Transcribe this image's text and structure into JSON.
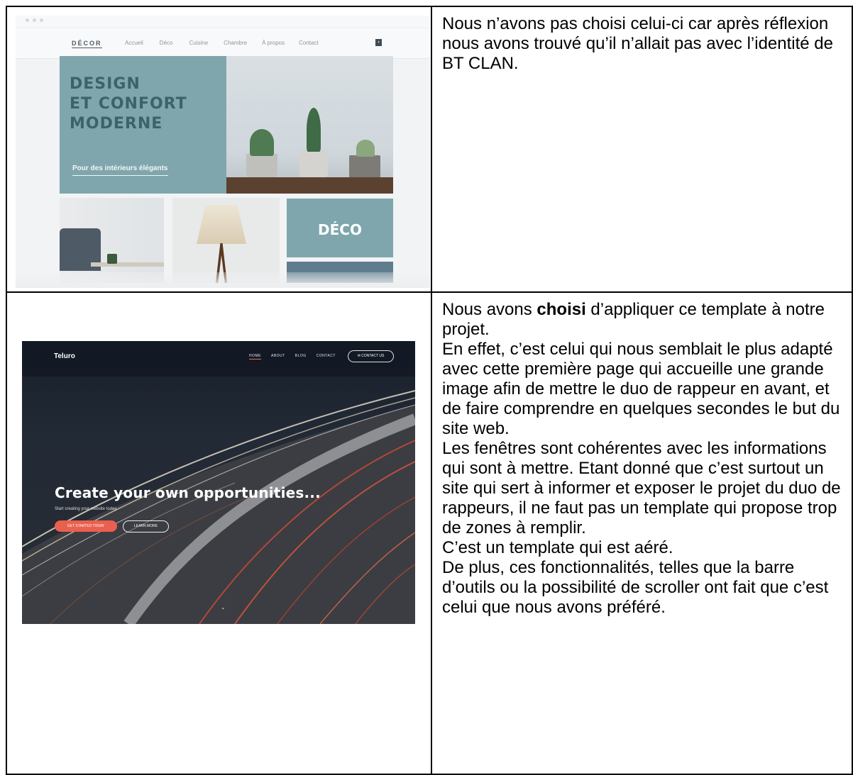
{
  "row1": {
    "thumbnail": {
      "brand": "DÉCOR",
      "nav": [
        "Accueil",
        "Déco",
        "Cuisine",
        "Chambre",
        "À propos",
        "Contact"
      ],
      "hero_title": [
        "DESIGN",
        "ET CONFORT",
        "MODERNE"
      ],
      "hero_subtitle": "Pour des intérieurs élégants",
      "tile_label": "DÉCO"
    },
    "text": "Nous n’avons pas choisi celui-ci car après réflexion nous avons trouvé qu’il n’allait pas avec l’identité de BT CLAN."
  },
  "row2": {
    "thumbnail": {
      "logo": "Teluro",
      "nav": [
        "HOME",
        "ABOUT",
        "BLOG",
        "CONTACT"
      ],
      "contact_button": "✉ CONTACT US",
      "title": "Create your own opportunities...",
      "subtitle": "Start creating your website today.",
      "primary_button": "GET STARTED TODAY",
      "secondary_button": "LEARN MORE",
      "scroll_icon": "chevron-down-icon"
    },
    "text_intro_before": "Nous avons ",
    "text_intro_bold": "choisi",
    "text_intro_after": " d’appliquer ce template à notre projet.",
    "paragraphs": [
      "En effet, c’est celui qui nous semblait le plus adapté avec cette première page qui accueille une grande image afin de mettre le duo de rappeur en avant, et de faire comprendre en quelques secondes le but du site web.",
      "Les fenêtres sont cohérentes avec les informations qui sont à mettre. Etant donné que c’est surtout un site qui sert à informer et exposer le projet du duo de rappeurs, il ne faut pas un template qui propose trop de zones à remplir.",
      "C’est un template qui est aéré.",
      "De plus, ces fonctionnalités, telles que la barre d’outils ou la possibilité de scroller ont fait que c’est celui que nous avons préféré."
    ]
  }
}
